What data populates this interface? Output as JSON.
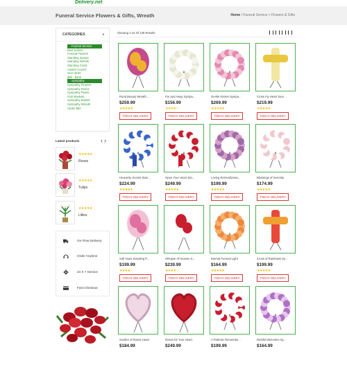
{
  "header": {
    "logo_fragment": "Delivery.net",
    "page_title": "Funeral Service Flowers & Gifts, Wreath",
    "breadcrumb_home": "Home",
    "breadcrumb_rest": " / Funeral Service > Flowers & Gifts"
  },
  "sidebar": {
    "categories_title": "CATEGORIES",
    "items": [
      {
        "label": "Funeral Service",
        "active": true
      },
      {
        "label": "Best Sellers",
        "active": false
      },
      {
        "label": "Funeral Flowers",
        "active": false
      },
      {
        "label": "Standing Sprays",
        "active": false
      },
      {
        "label": "Standing Wreath",
        "active": false
      },
      {
        "label": "Standing Cross",
        "active": false
      },
      {
        "label": "Casket Covers",
        "active": false
      },
      {
        "label": "Over $100",
        "active": false
      },
      {
        "label": "$50 - $100",
        "active": false
      },
      {
        "label": "Sympathy",
        "active": true
      },
      {
        "label": "Sympathy Flowers",
        "active": false
      },
      {
        "label": "Sympathy Roses",
        "active": false
      },
      {
        "label": "Sympathy Plants",
        "active": false
      },
      {
        "label": "Fruit Baskets",
        "active": false
      },
      {
        "label": "Sympathy Basket",
        "active": false
      },
      {
        "label": "Sympathy Wreath",
        "active": false
      },
      {
        "label": "Under $50",
        "active": false
      }
    ],
    "latest_title": "Latest products",
    "latest": [
      {
        "name": "Roses",
        "stars": "★★★★★",
        "rating": 5
      },
      {
        "name": "Tulips",
        "stars": "★★★★★",
        "rating": 5
      },
      {
        "name": "Lillies",
        "stars": "★★★★★",
        "rating": 5
      }
    ],
    "features": [
      {
        "label": "On-Time Delivery",
        "icon": "truck-icon"
      },
      {
        "label": "Order Anytime",
        "icon": "headset-icon"
      },
      {
        "label": "24 X 7 Service",
        "icon": "gear-icon"
      },
      {
        "label": "Fast Checkout",
        "icon": "card-icon"
      }
    ]
  },
  "toolbar": {
    "results_text": "Showing 1-24 Of 136 Results"
  },
  "products": [
    {
      "name": "Rural Beauty Wreath ...",
      "price": "$259.99",
      "stars": "★★★★★",
      "button": "TODAY DELIVERY"
    },
    {
      "name": "Far and Away Sympa...",
      "price": "$156.99",
      "stars": "★★★★☆",
      "button": "TODAY DELIVERY"
    },
    {
      "name": "Gentle Kisses Sympa...",
      "price": "$269.99",
      "stars": "★★★★★",
      "button": "TODAY DELIVERY"
    },
    {
      "name": "Cross my Heart Sure...",
      "price": "$219.99",
      "stars": "★★★★★",
      "button": "TODAY DELIVERY"
    },
    {
      "name": "Heavenly Scents Stan...",
      "price": "$224.99",
      "stars": "★★★★★",
      "button": "TODAY DELIVERY"
    },
    {
      "name": "Open Your Heart Sta...",
      "price": "$249.99",
      "stars": "★★★★★",
      "button": "TODAY DELIVERY"
    },
    {
      "name": "Loving Rememberan...",
      "price": "$199.99",
      "stars": "★★★★★",
      "button": "TODAY DELIVERY"
    },
    {
      "name": "Blessings of Serenity",
      "price": "$174.99",
      "stars": "★★★★★",
      "button": "TODAY DELIVERY"
    },
    {
      "name": "Soft Hues Standing P...",
      "price": "$199.99",
      "stars": "★★★★☆",
      "button": "TODAY DELIVERY"
    },
    {
      "name": "Glimpse of Heaven S...",
      "price": "$239.99",
      "stars": "★★★★☆",
      "button": "TODAY DELIVERY"
    },
    {
      "name": "Eternal Funeral Light",
      "price": "$164.99",
      "stars": "★★★★★",
      "button": "TODAY DELIVERY"
    },
    {
      "name": "Cross of Rainbows Sy...",
      "price": "$199.99",
      "stars": "★★★★★",
      "button": "TODAY DELIVERY"
    },
    {
      "name": "Garden of Roses Heart",
      "price": "$184.99",
      "stars": "",
      "button": ""
    },
    {
      "name": "Roses for Your Heart",
      "price": "$249.99",
      "stars": "",
      "button": ""
    },
    {
      "name": "A Patriotic Remembe...",
      "price": "$199.99",
      "stars": "",
      "button": ""
    },
    {
      "name": "Restful Memories Sy...",
      "price": "$164.99",
      "stars": "",
      "button": ""
    }
  ],
  "colors": {
    "accent_green": "#2b8a2b",
    "button_red": "#dd3333",
    "star_gold": "#f5b800"
  }
}
